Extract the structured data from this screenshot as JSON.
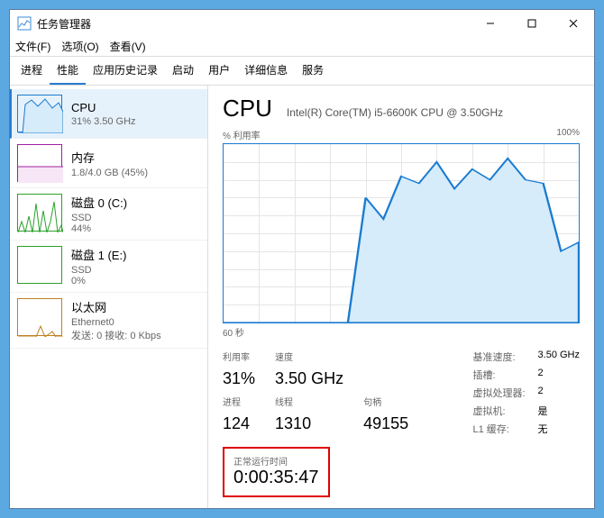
{
  "window_title": "任务管理器",
  "menu": {
    "file": "文件(F)",
    "options": "选项(O)",
    "view": "查看(V)"
  },
  "tabs": [
    "进程",
    "性能",
    "应用历史记录",
    "启动",
    "用户",
    "详细信息",
    "服务"
  ],
  "sidebar": {
    "items": [
      {
        "title": "CPU",
        "sub": "31% 3.50 GHz"
      },
      {
        "title": "内存",
        "sub": "1.8/4.0 GB (45%)"
      },
      {
        "title": "磁盘 0 (C:)",
        "sub": "SSD",
        "sub2": "44%"
      },
      {
        "title": "磁盘 1 (E:)",
        "sub": "SSD",
        "sub2": "0%"
      },
      {
        "title": "以太网",
        "sub": "Ethernet0",
        "sub2": "发送: 0 接收: 0 Kbps"
      }
    ]
  },
  "main": {
    "title": "CPU",
    "subtitle": "Intel(R) Core(TM) i5-6600K CPU @ 3.50GHz",
    "chart_top_left": "% 利用率",
    "chart_top_right": "100%",
    "x_axis": "60 秒"
  },
  "stats": {
    "row1": {
      "util_lbl": "利用率",
      "speed_lbl": "速度"
    },
    "row1v": {
      "util": "31%",
      "speed": "3.50 GHz"
    },
    "row2": {
      "proc_lbl": "进程",
      "thread_lbl": "线程",
      "handle_lbl": "句柄"
    },
    "row2v": {
      "proc": "124",
      "thread": "1310",
      "handle": "49155"
    },
    "right": {
      "base_speed_lbl": "基准速度:",
      "base_speed": "3.50 GHz",
      "sockets_lbl": "插槽:",
      "sockets": "2",
      "logical_lbl": "虚拟处理器:",
      "logical": "2",
      "virt_lbl": "虚拟机:",
      "virt": "是",
      "l1_lbl": "L1 缓存:",
      "l1": "无"
    }
  },
  "uptime": {
    "lbl": "正常运行时间",
    "val": "0:00:35:47"
  },
  "chart_data": {
    "type": "line",
    "xlabel": "60 秒",
    "ylabel": "% 利用率",
    "ylim": [
      0,
      100
    ],
    "x": [
      0,
      5,
      10,
      15,
      20,
      25,
      30,
      35,
      40,
      45,
      50,
      55,
      60,
      65,
      70,
      75,
      80,
      85,
      90,
      95,
      100
    ],
    "values": [
      0,
      0,
      0,
      0,
      0,
      0,
      0,
      0,
      70,
      58,
      82,
      78,
      90,
      75,
      86,
      80,
      92,
      80,
      78,
      40,
      45
    ]
  }
}
